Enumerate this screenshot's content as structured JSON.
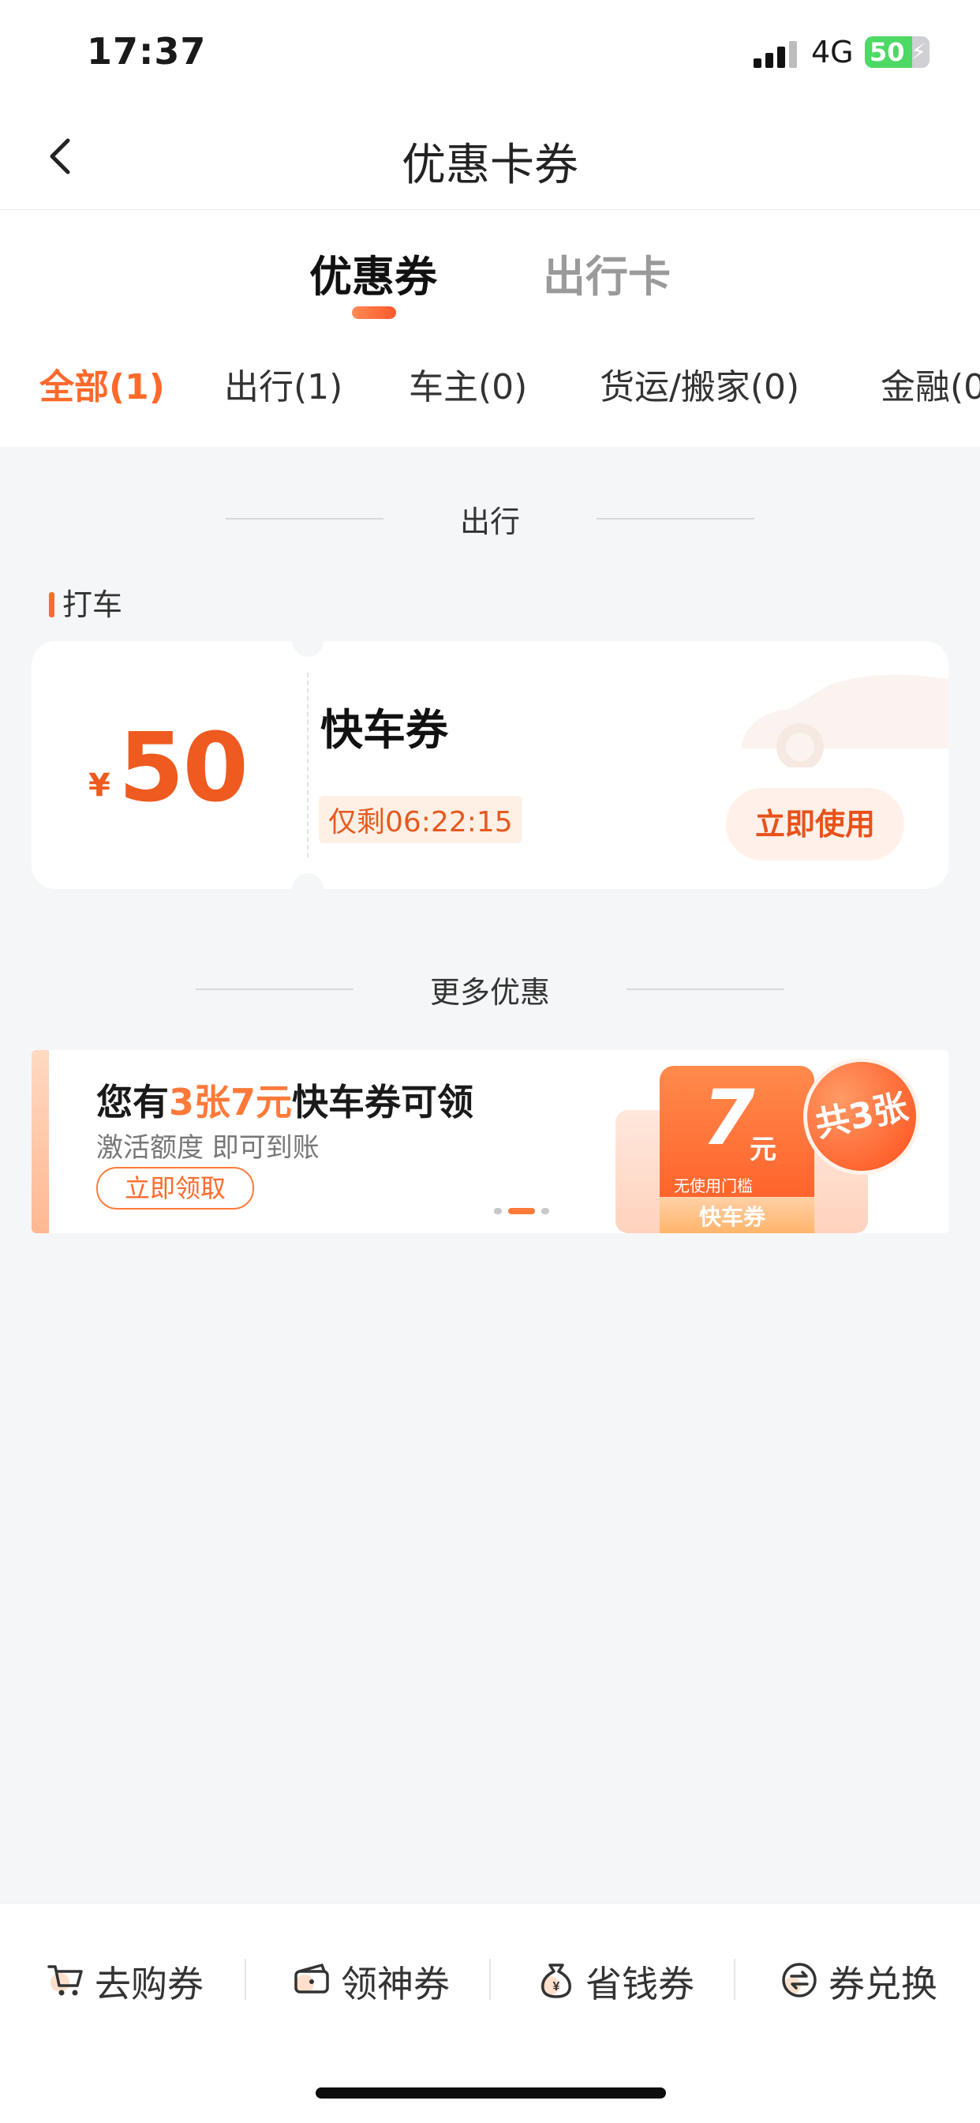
{
  "status_bar": {
    "time": "17:37",
    "network": "4G",
    "battery": "50"
  },
  "nav": {
    "title": "优惠卡券"
  },
  "main_tabs": [
    {
      "label": "优惠券",
      "active": true
    },
    {
      "label": "出行卡",
      "active": false
    }
  ],
  "sub_tabs": [
    {
      "label": "全部(1)",
      "active": true
    },
    {
      "label": "出行(1)"
    },
    {
      "label": "车主(0)"
    },
    {
      "label": "货运/搬家(0)"
    },
    {
      "label": "金融(0"
    }
  ],
  "sections": {
    "travel": "出行",
    "more": "更多优惠"
  },
  "group_label": "打车",
  "coupon": {
    "currency": "¥",
    "amount": "50",
    "name": "快车券",
    "countdown": "仅剩06:22:15",
    "use_label": "立即使用"
  },
  "banner": {
    "title_prefix": "您有",
    "title_highlight": "3张7元",
    "title_suffix": "快车券可领",
    "subtitle": "激活额度 即可到账",
    "claim_label": "立即领取",
    "voucher_value": "7",
    "voucher_unit": "元",
    "voucher_condition": "无使用门槛",
    "voucher_name": "快车券",
    "badge": "共3张"
  },
  "bottom_bar": [
    {
      "label": "去购券",
      "icon": "cart-icon"
    },
    {
      "label": "领神券",
      "icon": "ticket-icon"
    },
    {
      "label": "省钱券",
      "icon": "money-bag-icon"
    },
    {
      "label": "券兑换",
      "icon": "exchange-icon"
    }
  ],
  "colors": {
    "accent": "#ff6a2b",
    "price": "#ee5a1f",
    "background": "#f5f6f8"
  }
}
